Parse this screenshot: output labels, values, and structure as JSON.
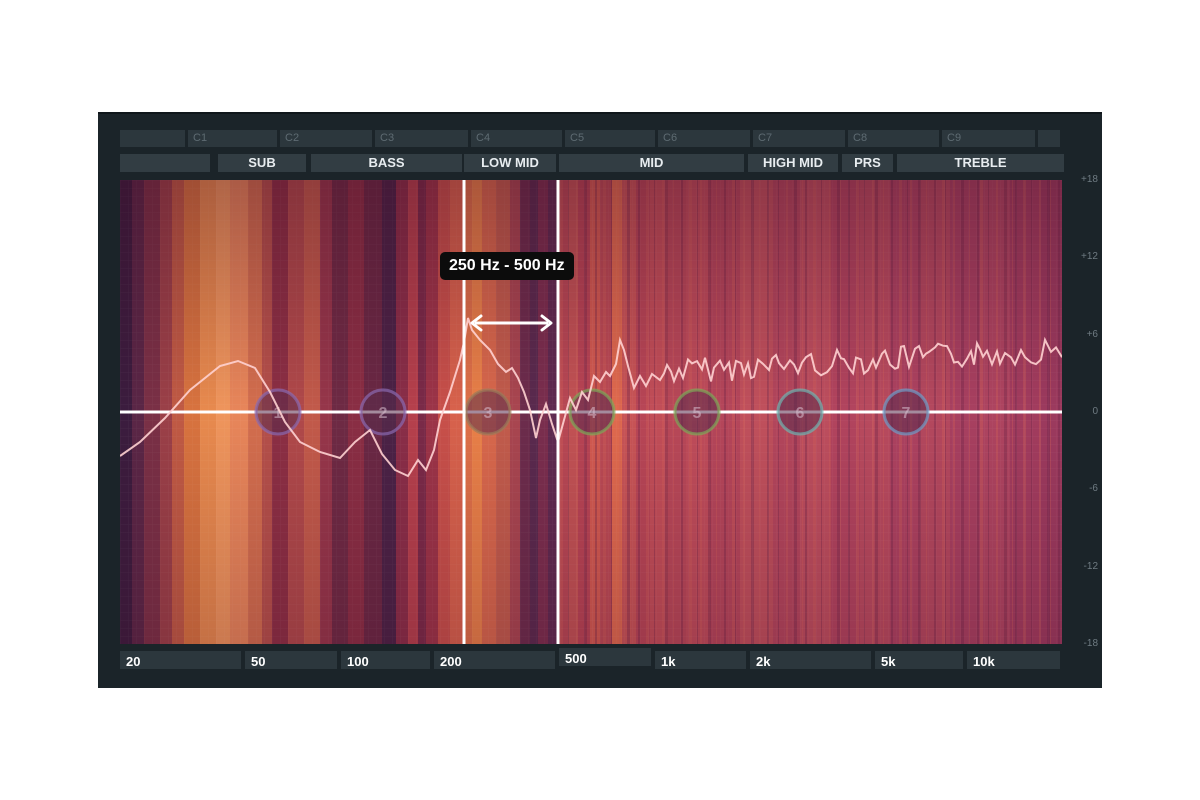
{
  "note_labels": [
    "",
    "C1",
    "C2",
    "C3",
    "C4",
    "C5",
    "C6",
    "C7",
    "C8",
    "C9",
    ""
  ],
  "bands": [
    "",
    "SUB",
    "BASS",
    "LOW MID",
    "MID",
    "HIGH MID",
    "PRS",
    "TREBLE"
  ],
  "freq_labels": [
    "20",
    "50",
    "100",
    "200",
    "500",
    "1k",
    "2k",
    "5k",
    "10k"
  ],
  "db_labels": [
    "+18",
    "+12",
    "+6",
    "0",
    "-6",
    "-12",
    "-18"
  ],
  "range_label": "250 Hz - 500 Hz",
  "eq_nodes": [
    "1",
    "2",
    "3",
    "4",
    "5",
    "6",
    "7"
  ],
  "colors": {
    "panel_bg": "#1b2429",
    "curve": "#ffd2d2",
    "zero_line": "#ffffff",
    "highlight_lines": "#ffffff",
    "node_green": "#7ea858",
    "node_cyan": "#6fb4b0",
    "node_blue": "#6f9cc8"
  }
}
